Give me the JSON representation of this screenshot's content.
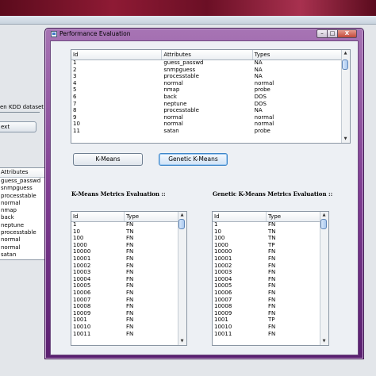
{
  "background_app": {
    "label_kdd": "en KDD dataset",
    "next_button": "ext",
    "attributes_table": {
      "header": "Attributes",
      "rows": [
        "guess_passwd",
        "snmpguess",
        "processtable",
        "normal",
        "nmap",
        "back",
        "neptune",
        "processtable",
        "normal",
        "normal",
        "satan"
      ]
    }
  },
  "window": {
    "title": "Performance Evaluation",
    "controls": {
      "minimize": "–",
      "maximize": "□",
      "close": "X"
    }
  },
  "attributes_table": {
    "columns": [
      "Id",
      "Attributes",
      "Types"
    ],
    "rows": [
      [
        "1",
        "guess_passwd",
        "NA"
      ],
      [
        "2",
        "snmpguess",
        "NA"
      ],
      [
        "3",
        "processtable",
        "NA"
      ],
      [
        "4",
        "normal",
        "normal"
      ],
      [
        "5",
        "nmap",
        "probe"
      ],
      [
        "6",
        "back",
        "DOS"
      ],
      [
        "7",
        "neptune",
        "DOS"
      ],
      [
        "8",
        "processtable",
        "NA"
      ],
      [
        "9",
        "normal",
        "normal"
      ],
      [
        "10",
        "normal",
        "normal"
      ],
      [
        "11",
        "satan",
        "probe"
      ]
    ]
  },
  "buttons": {
    "kmeans": "K-Means",
    "genetic_kmeans": "Genetic K-Means"
  },
  "kmeans_section": {
    "title": "K-Means Metrics Evaluation ::",
    "columns": [
      "Id",
      "Type"
    ],
    "rows": [
      [
        "1",
        "FN"
      ],
      [
        "10",
        "TN"
      ],
      [
        "100",
        "FN"
      ],
      [
        "1000",
        "FN"
      ],
      [
        "10000",
        "FN"
      ],
      [
        "10001",
        "FN"
      ],
      [
        "10002",
        "FN"
      ],
      [
        "10003",
        "FN"
      ],
      [
        "10004",
        "FN"
      ],
      [
        "10005",
        "FN"
      ],
      [
        "10006",
        "FN"
      ],
      [
        "10007",
        "FN"
      ],
      [
        "10008",
        "FN"
      ],
      [
        "10009",
        "FN"
      ],
      [
        "1001",
        "FN"
      ],
      [
        "10010",
        "FN"
      ],
      [
        "10011",
        "FN"
      ]
    ]
  },
  "genetic_section": {
    "title": "Genetic K-Means Metrics Evaluation ::",
    "columns": [
      "Id",
      "Type"
    ],
    "rows": [
      [
        "1",
        "FN"
      ],
      [
        "10",
        "TN"
      ],
      [
        "100",
        "TN"
      ],
      [
        "1000",
        "TP"
      ],
      [
        "10000",
        "FN"
      ],
      [
        "10001",
        "FN"
      ],
      [
        "10002",
        "FN"
      ],
      [
        "10003",
        "FN"
      ],
      [
        "10004",
        "FN"
      ],
      [
        "10005",
        "FN"
      ],
      [
        "10006",
        "FN"
      ],
      [
        "10007",
        "FN"
      ],
      [
        "10008",
        "FN"
      ],
      [
        "10009",
        "FN"
      ],
      [
        "1001",
        "TP"
      ],
      [
        "10010",
        "FN"
      ],
      [
        "10011",
        "FN"
      ]
    ]
  },
  "icons": {
    "scroll_up": "scroll-up-icon",
    "scroll_down": "scroll-down-icon",
    "window_icon": "java-window-icon"
  },
  "colors": {
    "title_bar_purple": "#7e3c91",
    "desktop_red": "#8e1a34",
    "selected_button_blue": "#3d85c8"
  }
}
